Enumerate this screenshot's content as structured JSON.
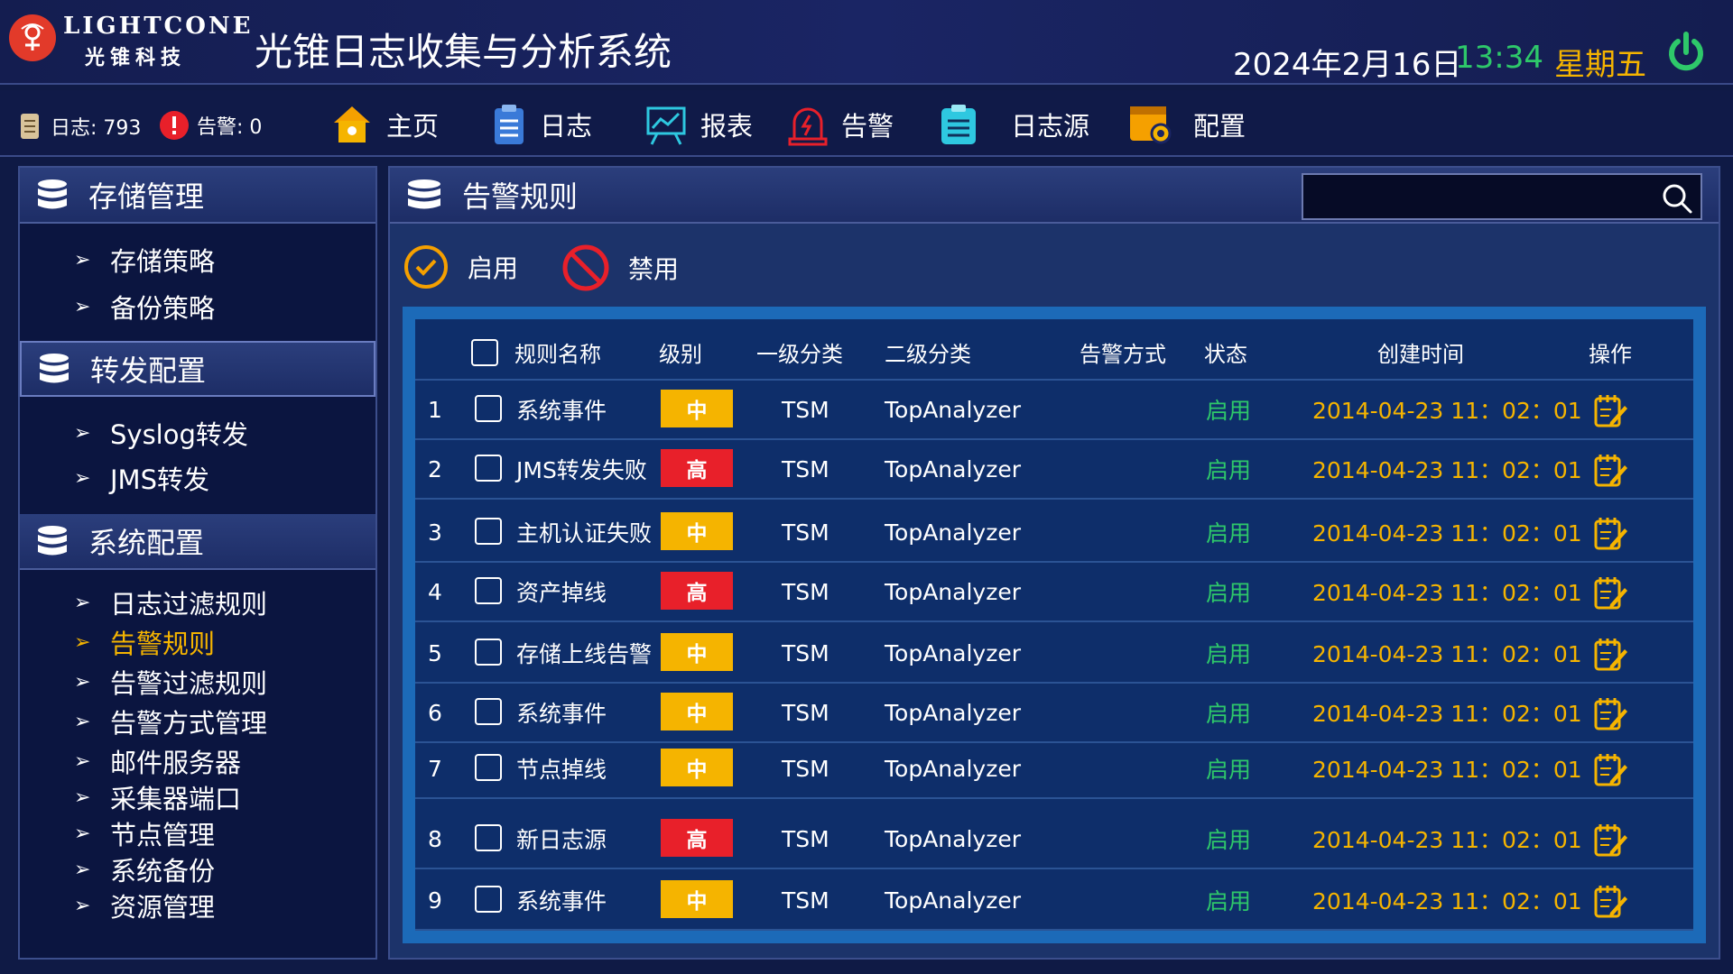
{
  "header": {
    "logo_en": "LIGHTCONE",
    "logo_cn": "光锥科技",
    "title": "光锥日志收集与分析系统",
    "date": "2024年2月16日",
    "time": "13:34",
    "weekday": "星期五",
    "power_icon": "power-icon"
  },
  "stats": {
    "log_label": "日志: 793",
    "alarm_label": "告警: 0"
  },
  "nav": [
    {
      "label": "主页",
      "icon": "home-icon"
    },
    {
      "label": "日志",
      "icon": "clipboard-icon"
    },
    {
      "label": "报表",
      "icon": "chart-board-icon"
    },
    {
      "label": "告警",
      "icon": "alarm-bell-icon"
    },
    {
      "label": "日志源",
      "icon": "log-source-icon"
    },
    {
      "label": "配置",
      "icon": "config-gear-icon"
    }
  ],
  "sidebar": {
    "groups": [
      {
        "title": "存储管理",
        "items": [
          "存储策略",
          "备份策略"
        ]
      },
      {
        "title": "转发配置",
        "items": [
          "Syslog转发",
          "JMS转发"
        ]
      },
      {
        "title": "系统配置",
        "items": [
          "日志过滤规则",
          "告警规则",
          "告警过滤规则",
          "告警方式管理",
          "邮件服务器",
          "采集器端口",
          "节点管理",
          "系统备份",
          "资源管理"
        ]
      }
    ],
    "active_item": "告警规则"
  },
  "main": {
    "title": "告警规则",
    "search_placeholder": "",
    "enable_label": "启用",
    "disable_label": "禁用"
  },
  "table": {
    "columns": [
      "规则名称",
      "级别",
      "一级分类",
      "二级分类",
      "告警方式",
      "状态",
      "创建时间",
      "操作"
    ],
    "rows": [
      {
        "no": "1",
        "name": "系统事件",
        "level": "中",
        "cat1": "TSM",
        "cat2": "TopAnalyzer",
        "method": "",
        "status": "启用",
        "created": "2014-04-23  11：02：01"
      },
      {
        "no": "2",
        "name": "JMS转发失败",
        "level": "高",
        "cat1": "TSM",
        "cat2": "TopAnalyzer",
        "method": "",
        "status": "启用",
        "created": "2014-04-23  11：02：01"
      },
      {
        "no": "3",
        "name": "主机认证失败",
        "level": "中",
        "cat1": "TSM",
        "cat2": "TopAnalyzer",
        "method": "",
        "status": "启用",
        "created": "2014-04-23  11：02：01"
      },
      {
        "no": "4",
        "name": "资产掉线",
        "level": "高",
        "cat1": "TSM",
        "cat2": "TopAnalyzer",
        "method": "",
        "status": "启用",
        "created": "2014-04-23  11：02：01"
      },
      {
        "no": "5",
        "name": "存储上线告警",
        "level": "中",
        "cat1": "TSM",
        "cat2": "TopAnalyzer",
        "method": "",
        "status": "启用",
        "created": "2014-04-23  11：02：01"
      },
      {
        "no": "6",
        "name": "系统事件",
        "level": "中",
        "cat1": "TSM",
        "cat2": "TopAnalyzer",
        "method": "",
        "status": "启用",
        "created": "2014-04-23  11：02：01"
      },
      {
        "no": "7",
        "name": "节点掉线",
        "level": "中",
        "cat1": "TSM",
        "cat2": "TopAnalyzer",
        "method": "",
        "status": "启用",
        "created": "2014-04-23  11：02：01"
      },
      {
        "no": "8",
        "name": "新日志源",
        "level": "高",
        "cat1": "TSM",
        "cat2": "TopAnalyzer",
        "method": "",
        "status": "启用",
        "created": "2014-04-23  11：02：01"
      },
      {
        "no": "9",
        "name": "系统事件",
        "level": "中",
        "cat1": "TSM",
        "cat2": "TopAnalyzer",
        "method": "",
        "status": "启用",
        "created": "2014-04-23  11：02：01"
      }
    ]
  },
  "colors": {
    "level_high": "#e8202a",
    "level_mid": "#f5b400",
    "status_green": "#2ec86a",
    "time_orange": "#f5b400",
    "active_orange": "#f5b400"
  }
}
